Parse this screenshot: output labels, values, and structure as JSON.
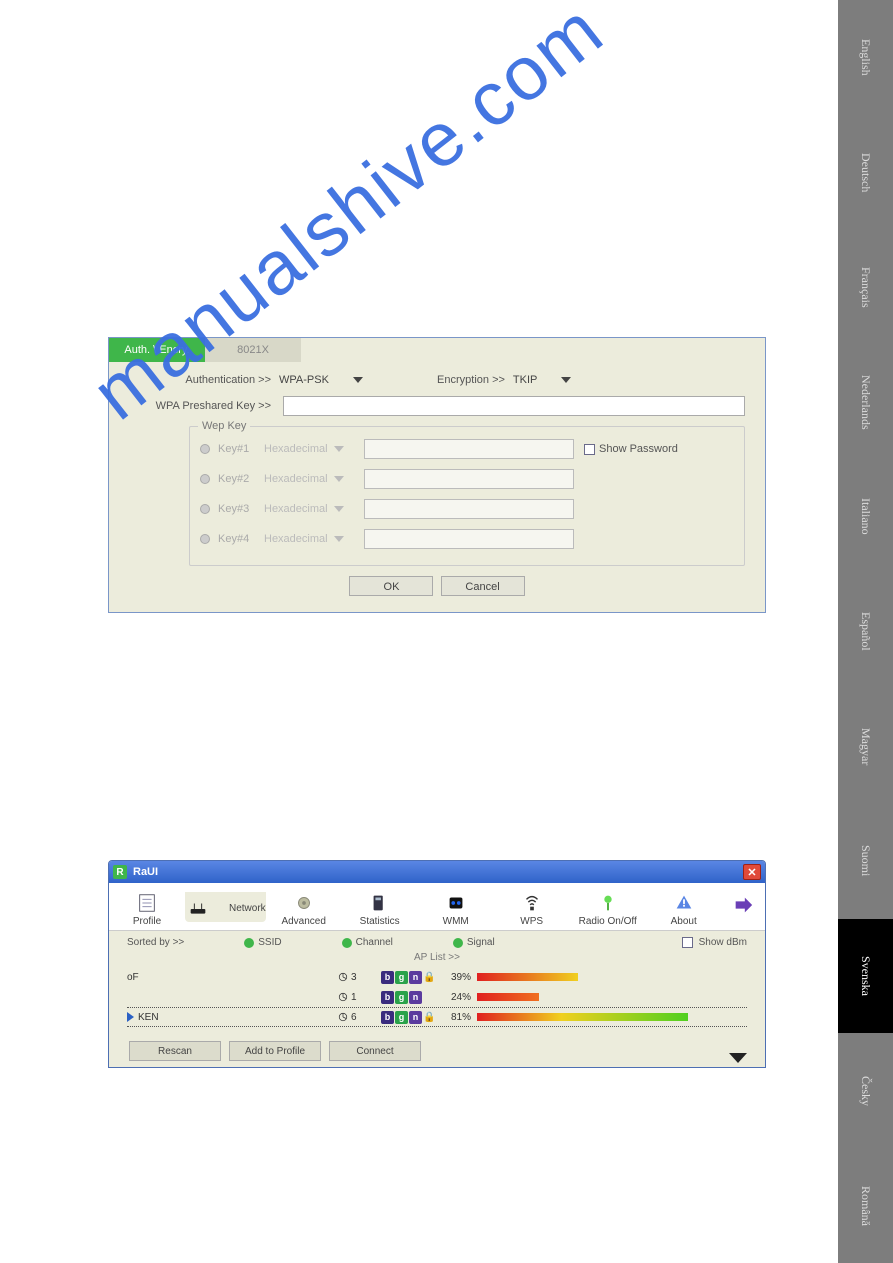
{
  "languages": [
    "English",
    "Deutsch",
    "Français",
    "Nederlands",
    "Italiano",
    "Español",
    "Magyar",
    "Suomi",
    "Svenska",
    "Česky",
    "Română"
  ],
  "active_language_index": 8,
  "watermark": "manualshive.com",
  "auth_dialog": {
    "tabs": {
      "active": "Auth. \\ Encry.",
      "inactive": "8021X"
    },
    "authentication_label": "Authentication >>",
    "authentication_value": "WPA-PSK",
    "encryption_label": "Encryption >>",
    "encryption_value": "TKIP",
    "psk_label": "WPA Preshared Key >>",
    "psk_value": "",
    "wep_legend": "Wep Key",
    "wep_keys": [
      {
        "name": "Key#1",
        "format": "Hexadecimal",
        "value": ""
      },
      {
        "name": "Key#2",
        "format": "Hexadecimal",
        "value": ""
      },
      {
        "name": "Key#3",
        "format": "Hexadecimal",
        "value": ""
      },
      {
        "name": "Key#4",
        "format": "Hexadecimal",
        "value": ""
      }
    ],
    "show_password_label": "Show Password",
    "ok": "OK",
    "cancel": "Cancel"
  },
  "raui": {
    "title": "RaUI",
    "toolbar": [
      "Profile",
      "Network",
      "Advanced",
      "Statistics",
      "WMM",
      "WPS",
      "Radio On/Off",
      "About"
    ],
    "active_toolbar_index": 1,
    "sortbar": {
      "label": "Sorted by >>",
      "opts": [
        "SSID",
        "Channel",
        "Signal"
      ],
      "show_dbm": "Show dBm"
    },
    "aplist_label": "AP List >>",
    "rows": [
      {
        "ssid": "oF",
        "channel": "3",
        "modes": [
          "b",
          "g",
          "n"
        ],
        "locked": true,
        "pct": "39%",
        "bar_pct": 39,
        "bar_class": "g-low",
        "selected": false
      },
      {
        "ssid": "",
        "channel": "1",
        "modes": [
          "b",
          "g",
          "n"
        ],
        "locked": false,
        "pct": "24%",
        "bar_pct": 24,
        "bar_class": "g-mid",
        "selected": false
      },
      {
        "ssid": "KEN",
        "channel": "6",
        "modes": [
          "b",
          "g",
          "n"
        ],
        "locked": true,
        "pct": "81%",
        "bar_pct": 81,
        "bar_class": "g-high",
        "selected": true
      }
    ],
    "footer": [
      "Rescan",
      "Add to Profile",
      "Connect"
    ]
  }
}
